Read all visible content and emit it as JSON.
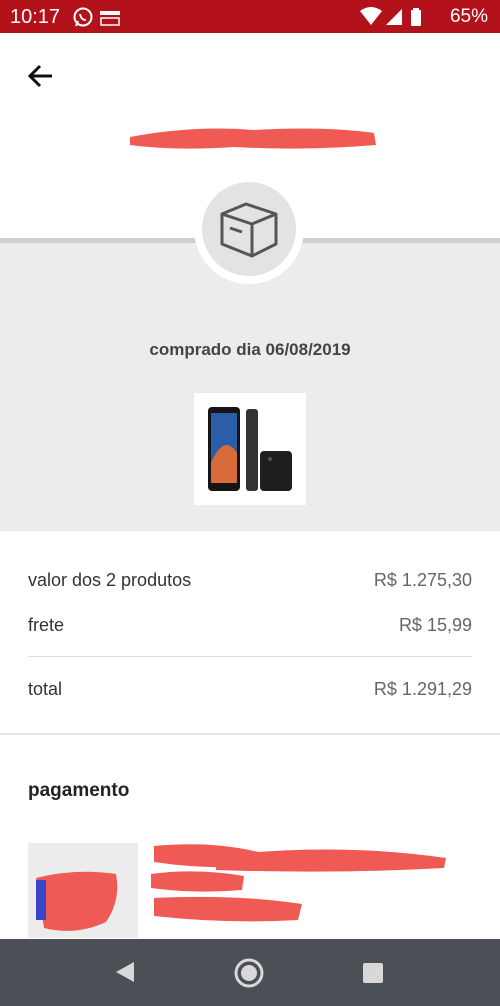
{
  "status_bar": {
    "time": "10:17",
    "battery": "65%",
    "icons": [
      "whatsapp-icon",
      "amazon-notification-icon",
      "wifi-icon",
      "signal-icon",
      "battery-icon"
    ],
    "color": "#b3121b"
  },
  "header": {
    "back_icon": "arrow-left-icon"
  },
  "order": {
    "purchase_date": "comprado dia 06/08/2019",
    "box_icon": "package-box-icon"
  },
  "summary": {
    "rows": [
      {
        "label": "valor dos 2 produtos",
        "value": "R$ 1.275,30"
      },
      {
        "label": "frete",
        "value": "R$ 15,99"
      }
    ],
    "total": {
      "label": "total",
      "value": "R$ 1.291,29"
    }
  },
  "payment": {
    "title": "pagamento"
  },
  "nav": {
    "icons": [
      "nav-back-icon",
      "nav-home-icon",
      "nav-recent-icon"
    ]
  }
}
